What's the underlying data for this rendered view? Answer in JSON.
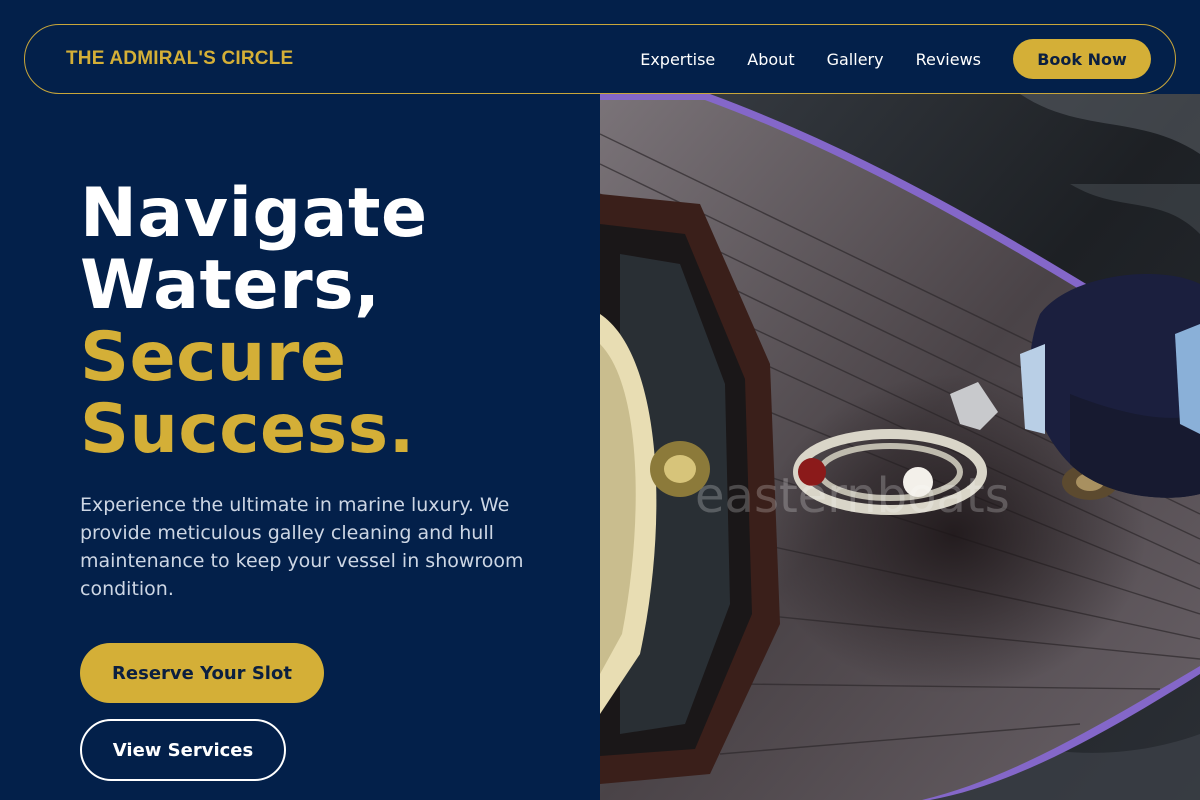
{
  "nav": {
    "brand": "THE ADMIRAL'S CIRCLE",
    "links": [
      "Expertise",
      "About",
      "Gallery",
      "Reviews"
    ],
    "cta": "Book Now"
  },
  "hero": {
    "headline_white": [
      "Navigate",
      "Waters,"
    ],
    "headline_gold": [
      "Secure",
      "Success."
    ],
    "lead": "Experience the ultimate in marine luxury. We provide meticulous galley cleaning and hull maintenance to keep your vessel in showroom condition.",
    "primary_cta": "Reserve Your Slot",
    "secondary_cta": "View Services",
    "image_watermark": "easternboats"
  },
  "colors": {
    "background": "#03204a",
    "accent": "#d4af37",
    "text_light": "#ffffff",
    "text_muted": "#cdd6e4"
  }
}
